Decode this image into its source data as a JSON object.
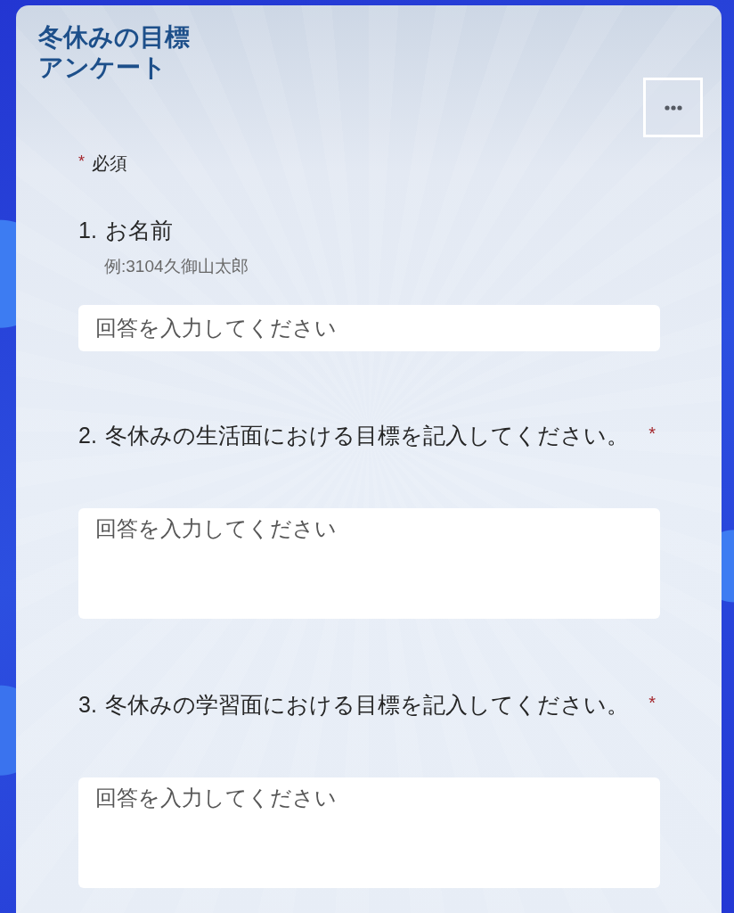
{
  "form": {
    "title": "冬休みの目標アンケート"
  },
  "required_note": {
    "mark": "*",
    "label": "必須"
  },
  "questions": [
    {
      "number": "1.",
      "label": "お名前",
      "hint": "例:3104久御山太郎",
      "kind": "short",
      "placeholder": "回答を入力してください"
    },
    {
      "number": "2.",
      "label": "冬休みの生活面における目標を記入してください。",
      "required_mark": "*",
      "kind": "long",
      "placeholder": "回答を入力してください"
    },
    {
      "number": "3.",
      "label": "冬休みの学習面における目標を記入してください。",
      "required_mark": "*",
      "kind": "long",
      "placeholder": "回答を入力してください"
    }
  ]
}
